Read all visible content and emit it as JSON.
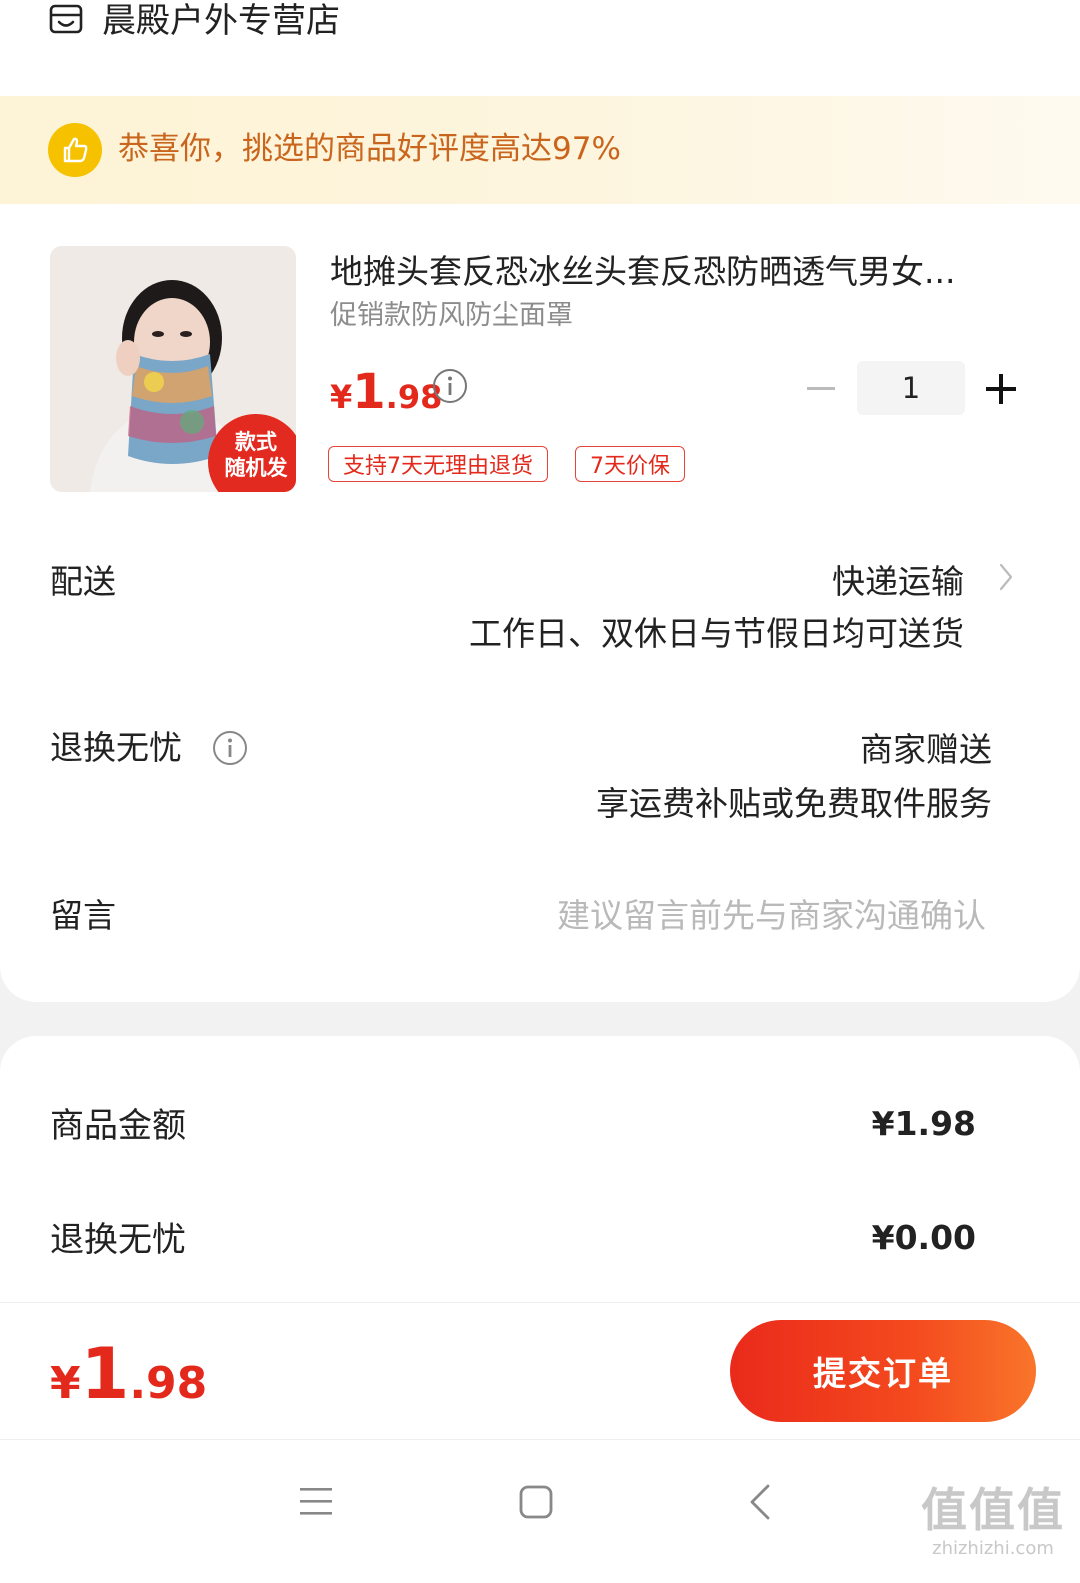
{
  "store": {
    "name": "晨殿户外专营店",
    "icon": "store-icon"
  },
  "banner": {
    "text": "恭喜你，挑选的商品好评度高达97%",
    "icon": "thumbs-up-icon",
    "color": "#c9651c"
  },
  "product": {
    "title": "地摊头套反恐冰丝头套反恐防晒透气男女...",
    "sku": "促销款防风防尘面罩",
    "image_badge_line1": "款式",
    "image_badge_line2": "随机发",
    "price_symbol": "¥",
    "price_int": "1",
    "price_dec": ".98",
    "quantity": "1",
    "tags": [
      "支持7天无理由退货",
      "7天价保"
    ]
  },
  "delivery": {
    "label": "配送",
    "method": "快递运输",
    "note": "工作日、双休日与节假日均可送货"
  },
  "return_worry_free": {
    "label": "退换无忧",
    "value": "商家赠送",
    "note": "享运费补贴或免费取件服务"
  },
  "message": {
    "label": "留言",
    "placeholder": "建议留言前先与商家沟通确认"
  },
  "summary": {
    "items": [
      {
        "label": "商品金额",
        "value": "¥1.98"
      },
      {
        "label": "退换无忧",
        "value": "¥0.00"
      }
    ]
  },
  "footer": {
    "total_symbol": "¥",
    "total_int": "1",
    "total_dec": ".98",
    "submit_label": "提交订单",
    "accent": "#e3291b"
  },
  "watermark": {
    "mark": "值值值",
    "url": "zhizhizhi.com"
  }
}
